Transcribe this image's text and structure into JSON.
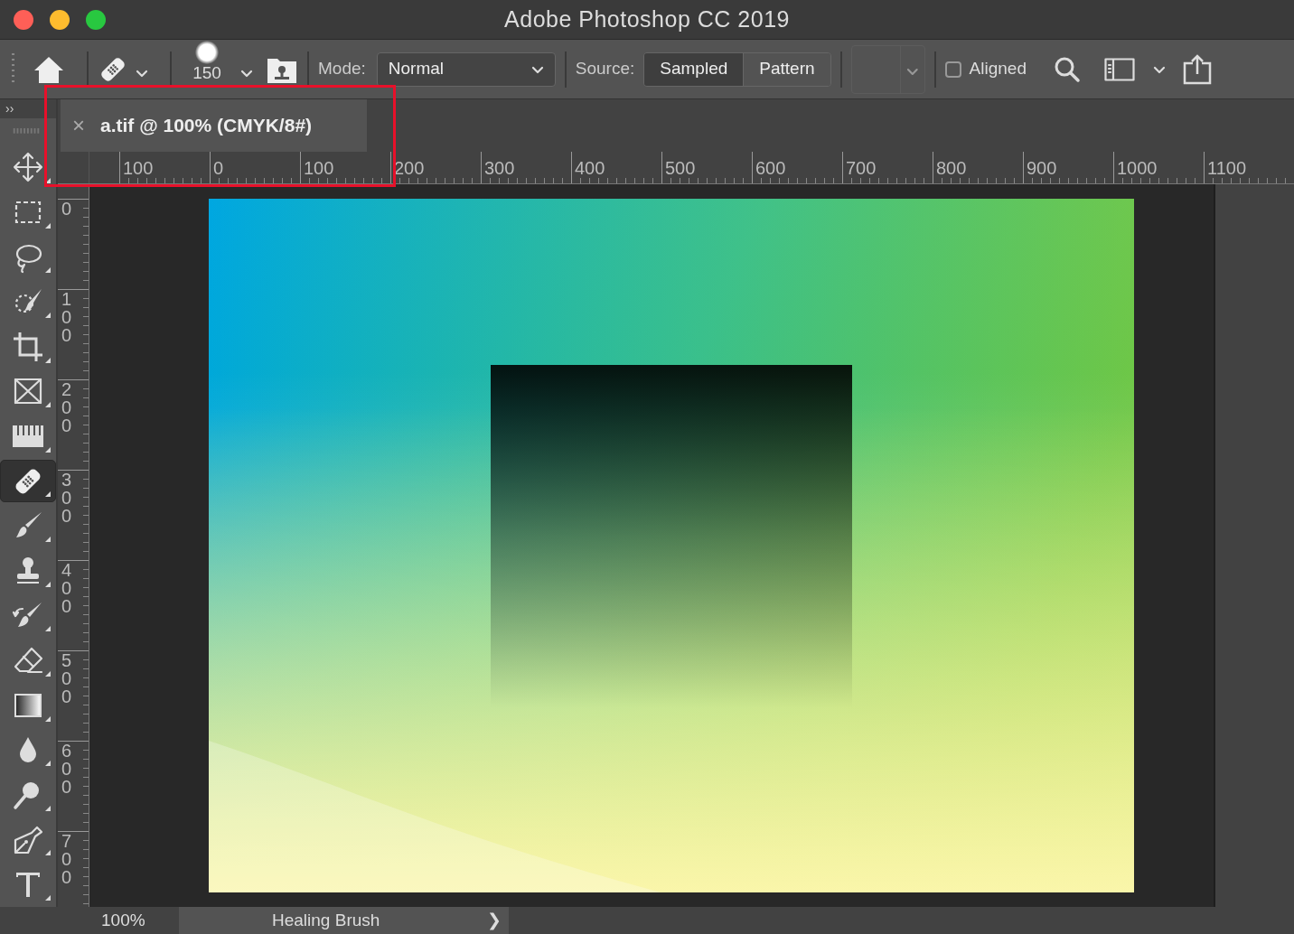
{
  "window": {
    "title": "Adobe Photoshop CC 2019"
  },
  "options_bar": {
    "brush_size": "150",
    "mode_label": "Mode:",
    "mode_value": "Normal",
    "source_label": "Source:",
    "source_options": [
      {
        "label": "Sampled",
        "selected": true
      },
      {
        "label": "Pattern",
        "selected": false
      }
    ],
    "aligned": {
      "label": "Aligned",
      "checked": false
    }
  },
  "panel_toggle": "››",
  "document_tab": {
    "title": "a.tif @ 100% (CMYK/8#)",
    "close": "×"
  },
  "ruler_h": [
    "100",
    "0",
    "100",
    "200",
    "300",
    "400",
    "500",
    "600",
    "700",
    "800",
    "900",
    "1000",
    "1100"
  ],
  "ruler_v": [
    "0",
    "100",
    "200",
    "300",
    "400",
    "500",
    "600",
    "700"
  ],
  "tools": [
    {
      "kind": "move",
      "selected": false
    },
    {
      "kind": "marquee",
      "selected": false
    },
    {
      "kind": "lasso",
      "selected": false
    },
    {
      "kind": "quickselect",
      "selected": false
    },
    {
      "kind": "crop",
      "selected": false
    },
    {
      "kind": "frame",
      "selected": false
    },
    {
      "kind": "ruler",
      "selected": false
    },
    {
      "kind": "healing",
      "selected": true
    },
    {
      "kind": "brush",
      "selected": false
    },
    {
      "kind": "stamp",
      "selected": false
    },
    {
      "kind": "history",
      "selected": false
    },
    {
      "kind": "eraser",
      "selected": false
    },
    {
      "kind": "gradient",
      "selected": false
    },
    {
      "kind": "blur",
      "selected": false
    },
    {
      "kind": "dodge",
      "selected": false
    },
    {
      "kind": "pen",
      "selected": false
    },
    {
      "kind": "type",
      "selected": false
    }
  ],
  "status_bar": {
    "zoom": "100%",
    "info": "Healing Brush",
    "arrow": "❯"
  },
  "highlight_frame": true
}
